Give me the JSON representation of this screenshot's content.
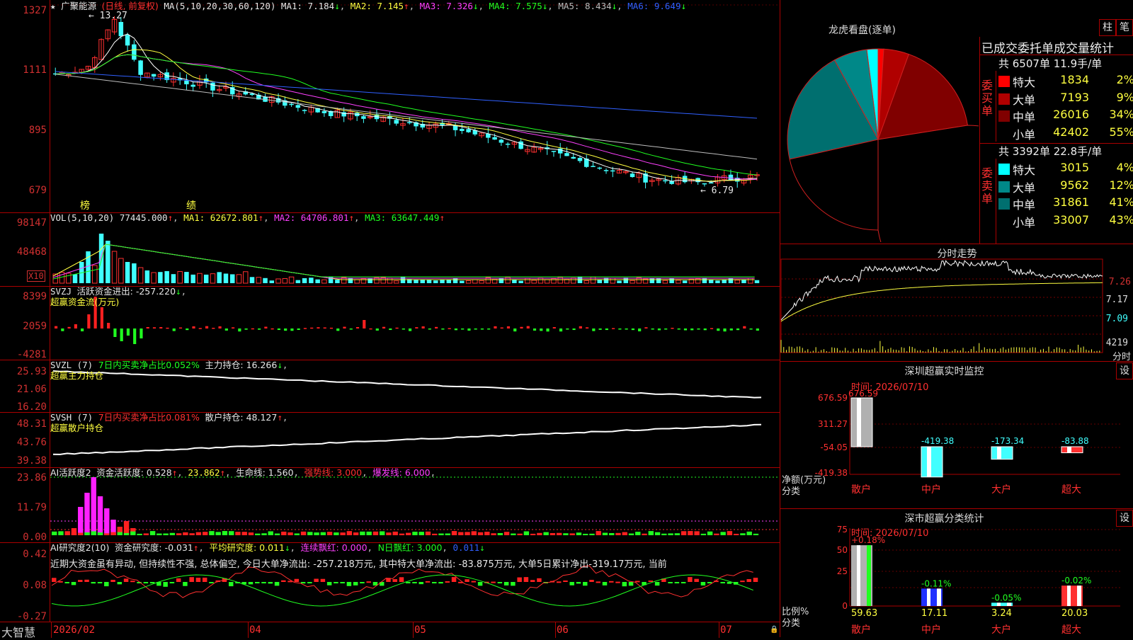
{
  "header": {
    "star": "★",
    "name": "广聚能源",
    "mode": "(日线, 前复权)",
    "ma_label": "MA(5,10,20,30,60,120)",
    "ma1": "MA1: 7.184",
    "ma2": "MA2: 7.145",
    "ma3": "MA3: 7.326",
    "ma4": "MA4: 7.575",
    "ma5": "MA5: 8.434",
    "ma6": "MA6: 9.649"
  },
  "main_axis": [
    "1327",
    "1111",
    "895",
    "679"
  ],
  "annotations": {
    "high": "13.27",
    "low": "6.79",
    "bang": "榜",
    "ji": "绩"
  },
  "vol": {
    "label": "VOL(5,10,20)",
    "value": "77445.000",
    "ma1": "MA1: 62672.801",
    "ma2": "MA2: 64706.801",
    "ma3": "MA3: 63647.449",
    "axis": [
      "98147",
      "48468"
    ],
    "x10": "X10"
  },
  "svzj": {
    "label": "SVZJ",
    "title": "活跃资金进出: -257.220",
    "sub": "超赢资金流(万元)",
    "axis": [
      "8399",
      "2059",
      "-4281"
    ]
  },
  "svzl": {
    "label": "SVZL (7)",
    "ratio": "7日内买卖净占比0.052%",
    "hold": "主力持仓: 16.266",
    "sub": "超赢主力持仓",
    "axis": [
      "25.93",
      "21.06",
      "16.20"
    ]
  },
  "svsh": {
    "label": "SVSH (7)",
    "ratio": "7日内买卖净占比0.081%",
    "hold": "散户持仓: 48.127",
    "sub": "超赢散户持仓",
    "axis": [
      "48.31",
      "43.76",
      "39.38"
    ]
  },
  "ai1": {
    "label": "AI活跃度2",
    "a": "资金活跃度: 0.528",
    "b": "23.862",
    "c": "生命线: 1.560",
    "d": "强势线: 3.000",
    "e": "爆发线: 6.000",
    "axis": [
      "23.86",
      "11.79",
      "0.00"
    ]
  },
  "ai2": {
    "label": "AI研究度2(10)",
    "a": "资金研究度: -0.031",
    "b": "平均研究度: 0.011",
    "c": "连续飘红: 0.000",
    "d": "N日飘红: 3.000",
    "e": "0.011",
    "axis": [
      "0.42",
      "0.08",
      "-0.27"
    ],
    "comment": "近期大资金虽有异动, 但持续性不强, 总体偏空, 今日大单净流出: -257.218万元, 其中特大单净流出: -83.875万元, 大单5日累计净出-319.17万元, 当前"
  },
  "x_dates": [
    "2026/02",
    "04",
    "05",
    "06",
    "07"
  ],
  "bottom_brand": "大智慧",
  "right": {
    "longhu": {
      "title": "龙虎看盘(逐单)",
      "btn1": "柱",
      "btn2": "笔",
      "stat_title": "已成交委托单成交量统计"
    },
    "buy": {
      "summary": "共 6507单 11.9手/单",
      "side": "委买单",
      "rows": [
        {
          "name": "特大",
          "val": "1834",
          "pct": "2%",
          "color": "#ff0000"
        },
        {
          "name": "大单",
          "val": "7193",
          "pct": "9%",
          "color": "#b00000"
        },
        {
          "name": "中单",
          "val": "26016",
          "pct": "34%",
          "color": "#800000"
        },
        {
          "name": "小单",
          "val": "42402",
          "pct": "55%",
          "color": "#000000"
        }
      ]
    },
    "sell": {
      "summary": "共 3392单 22.8手/单",
      "side": "委卖单",
      "rows": [
        {
          "name": "特大",
          "val": "3015",
          "pct": "4%",
          "color": "#00ffff"
        },
        {
          "name": "大单",
          "val": "9562",
          "pct": "12%",
          "color": "#008888"
        },
        {
          "name": "中单",
          "val": "31861",
          "pct": "41%",
          "color": "#006f6f"
        },
        {
          "name": "小单",
          "val": "33007",
          "pct": "43%",
          "color": "#000000"
        }
      ]
    },
    "intraday": {
      "title": "分时走势",
      "axis": [
        "7.26",
        "7.17",
        "7.09",
        "4219"
      ],
      "fen": "分时"
    },
    "szmon": {
      "title": "深圳超赢实时监控",
      "btn": "设",
      "time": "时间: 2026/07/10",
      "axis": [
        "676.59",
        "311.27",
        "-54.05",
        "-419.38"
      ],
      "ylabel1": "净额(万元)",
      "ylabel2": "分类",
      "bars": [
        {
          "cat": "散户",
          "val": "676.59"
        },
        {
          "cat": "中户",
          "val": "-419.38"
        },
        {
          "cat": "大户",
          "val": "-173.34"
        },
        {
          "cat": "超大",
          "val": "-83.88"
        }
      ]
    },
    "szcls": {
      "title": "深市超赢分类统计",
      "btn": "设",
      "time": "时间: 2026/07/10",
      "axis": [
        "75",
        "50",
        "25",
        "0"
      ],
      "ylabel1": "比例%",
      "ylabel2": "分类",
      "bars": [
        {
          "cat": "散户",
          "top": "+0.18%",
          "val": "59.63"
        },
        {
          "cat": "中户",
          "top": "-0.11%",
          "val": "17.11"
        },
        {
          "cat": "大户",
          "top": "-0.05%",
          "val": "3.24"
        },
        {
          "cat": "超大",
          "top": "-0.02%",
          "val": "20.03"
        }
      ]
    }
  }
}
